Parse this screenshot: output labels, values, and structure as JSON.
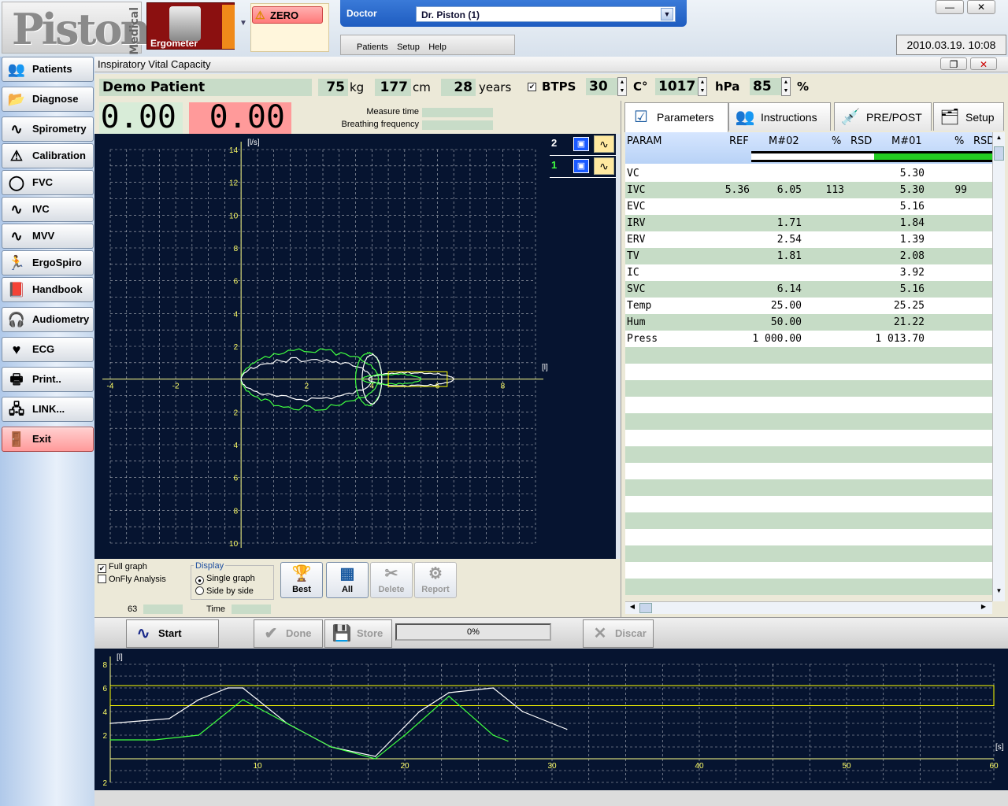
{
  "app": {
    "logo_text": "Piston",
    "logo_sub": "Medical",
    "module_label": "Ergometer",
    "zero_label": "ZERO",
    "doctor_label": "Doctor",
    "doctor_value": "Dr. Piston (1)",
    "menu": [
      "Patients",
      "Setup",
      "Help"
    ],
    "datetime": "2010.03.19. 10:08",
    "window_title": "Inspiratory Vital Capacity"
  },
  "sidebar": [
    {
      "label": "Patients",
      "icon": "patients-icon",
      "glyph": "👥"
    },
    {
      "label": "Diagnose",
      "icon": "folder-icon",
      "glyph": "📂"
    },
    {
      "label": "Spirometry",
      "icon": "wave-icon",
      "glyph": "∿"
    },
    {
      "label": "Calibration",
      "icon": "warning-icon",
      "glyph": "⚠"
    },
    {
      "label": "FVC",
      "icon": "loop-icon",
      "glyph": "◯"
    },
    {
      "label": "IVC",
      "icon": "wave-icon",
      "glyph": "∿"
    },
    {
      "label": "MVV",
      "icon": "wave-gauge-icon",
      "glyph": "∿"
    },
    {
      "label": "ErgoSpiro",
      "icon": "runner-icon",
      "glyph": "🏃"
    },
    {
      "label": "Handbook",
      "icon": "book-icon",
      "glyph": "📕"
    },
    {
      "label": "Audiometry",
      "icon": "headphones-icon",
      "glyph": "🎧"
    },
    {
      "label": "ECG",
      "icon": "ecg-icon",
      "glyph": "♥"
    },
    {
      "label": "Print..",
      "icon": "printer-icon",
      "glyph": "🖶"
    },
    {
      "label": "LINK...",
      "icon": "link-icon",
      "glyph": "🖧"
    },
    {
      "label": "Exit",
      "icon": "exit-icon",
      "glyph": "🚪"
    }
  ],
  "patient": {
    "name": "Demo Patient",
    "weight": "75",
    "weight_unit": "kg",
    "height": "177",
    "height_unit": "cm",
    "age": "28",
    "age_unit": "years",
    "btps_label": "BTPS",
    "temp": "30",
    "temp_unit": "C°",
    "pressure": "1017",
    "pressure_unit": "hPa",
    "humidity": "85",
    "humidity_unit": "%"
  },
  "readout": {
    "value1": "0.00",
    "value2": "0.00",
    "measure_time_label": "Measure time",
    "breathing_freq_label": "Breathing frequency"
  },
  "trials": [
    {
      "num": "2",
      "color": "#ffffff"
    },
    {
      "num": "1",
      "color": "#40ff40"
    }
  ],
  "controls": {
    "full_graph": "Full graph",
    "onfly": "OnFly Analysis",
    "display_label": "Display",
    "single_graph": "Single graph",
    "side_by_side": "Side by side",
    "counter": "63",
    "time_label": "Time",
    "best": "Best",
    "all": "All",
    "delete": "Delete",
    "report": "Report"
  },
  "tabs": [
    "Parameters",
    "Instructions",
    "PRE/POST",
    "Setup"
  ],
  "param_table": {
    "headers": [
      "PARAM",
      "REF",
      "M#02",
      "%",
      "RSD",
      "M#01",
      "%",
      "RSD"
    ],
    "rows": [
      [
        "VC",
        "",
        "",
        "",
        "",
        "5.30",
        "",
        ""
      ],
      [
        "IVC",
        "5.36",
        "6.05",
        "113",
        "",
        "5.30",
        "99",
        ""
      ],
      [
        "EVC",
        "",
        "",
        "",
        "",
        "5.16",
        "",
        ""
      ],
      [
        "IRV",
        "",
        "1.71",
        "",
        "",
        "1.84",
        "",
        ""
      ],
      [
        "ERV",
        "",
        "2.54",
        "",
        "",
        "1.39",
        "",
        ""
      ],
      [
        "TV",
        "",
        "1.81",
        "",
        "",
        "2.08",
        "",
        ""
      ],
      [
        "IC",
        "",
        "",
        "",
        "",
        "3.92",
        "",
        ""
      ],
      [
        "SVC",
        "",
        "6.14",
        "",
        "",
        "5.16",
        "",
        ""
      ],
      [
        "Temp",
        "",
        "25.00",
        "",
        "",
        "25.25",
        "",
        ""
      ],
      [
        "Hum",
        "",
        "50.00",
        "",
        "",
        "21.22",
        "",
        ""
      ],
      [
        "Press",
        "",
        "1 000.00",
        "",
        "",
        "1 013.70",
        "",
        ""
      ]
    ]
  },
  "actions": {
    "start": "Start",
    "done": "Done",
    "store": "Store",
    "progress": "0%",
    "discard": "Discar"
  },
  "colors": {
    "graph_bg": "#061430",
    "grid": "#ffffff",
    "axis_label": "#ffff66",
    "trace_1": "#40ff40",
    "trace_2": "#ffffff",
    "accent": "#1e5cc0"
  },
  "chart_data": [
    {
      "type": "line",
      "title": "",
      "xlabel": "[l]",
      "ylabel": "[l/s]",
      "xlim": [
        -4,
        9
      ],
      "ylim": [
        -10,
        14
      ],
      "x_ticks": [
        -4,
        -2,
        2,
        4,
        6,
        8
      ],
      "y_ticks_top": [
        14,
        12,
        10,
        8,
        6,
        4,
        2
      ],
      "y_ticks_bottom": [
        2,
        4,
        6,
        8,
        10
      ],
      "grid": true
    },
    {
      "type": "line",
      "title": "",
      "xlabel": "[s]",
      "ylabel": "[l]",
      "xlim": [
        0,
        60
      ],
      "ylim": [
        -2,
        8
      ],
      "x_ticks": [
        10,
        20,
        30,
        40,
        50,
        60
      ],
      "y_ticks": [
        8,
        6,
        4,
        2,
        2
      ],
      "grid": true,
      "series": [
        {
          "x": [
            0,
            2,
            4,
            6,
            8,
            9,
            12,
            15,
            18,
            21,
            23,
            26,
            28,
            31
          ],
          "values": [
            3,
            3.2,
            3.4,
            5,
            6,
            6,
            3,
            1,
            0.2,
            4,
            5.6,
            6,
            4,
            2.5
          ]
        },
        {
          "x": [
            0,
            3,
            6,
            9,
            12,
            15,
            18,
            20,
            23,
            26,
            27
          ],
          "values": [
            1.6,
            1.6,
            2,
            5,
            3,
            1,
            0,
            2,
            5.3,
            2,
            1.5
          ]
        }
      ]
    }
  ]
}
